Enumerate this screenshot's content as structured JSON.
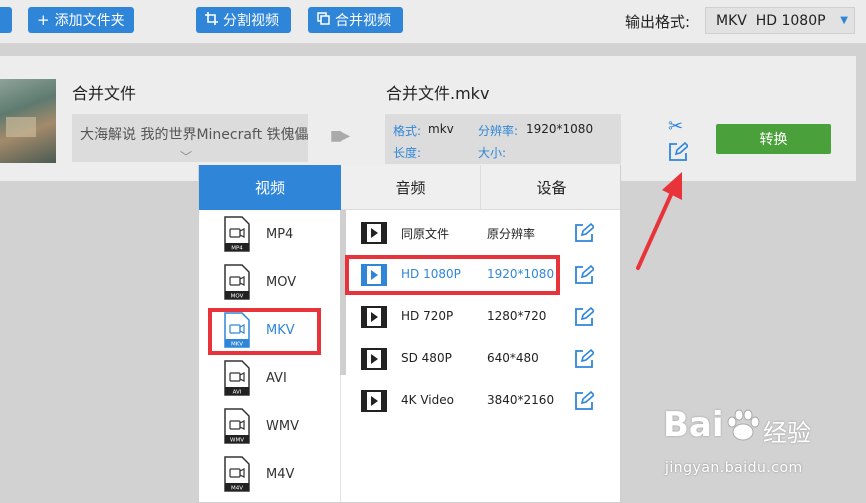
{
  "toolbar": {
    "add_folder": "添加文件夹",
    "split_video": "分割视频",
    "merge_video": "合并视频",
    "output_format_label": "输出格式:",
    "output_format_value": "MKV  HD 1080P"
  },
  "file": {
    "source_name": "合并文件",
    "source_detail": "大海解说 我的世界Minecraft 铁傀儡",
    "output_name": "合并文件.mkv",
    "format_key": "格式:",
    "format_value": "mkv",
    "resolution_key": "分辨率:",
    "resolution_value": "1920*1080",
    "duration_key": "长度:",
    "size_key": "大小:",
    "convert_label": "转换"
  },
  "popup": {
    "tabs": [
      "视频",
      "音频",
      "设备"
    ],
    "formats": [
      {
        "label": "MP4",
        "selected": false
      },
      {
        "label": "MOV",
        "selected": false
      },
      {
        "label": "MKV",
        "selected": true
      },
      {
        "label": "AVI",
        "selected": false
      },
      {
        "label": "WMV",
        "selected": false
      },
      {
        "label": "M4V",
        "selected": false
      }
    ],
    "presets": [
      {
        "name": "同原文件",
        "res": "原分辨率",
        "selected": false
      },
      {
        "name": "HD 1080P",
        "res": "1920*1080",
        "selected": true
      },
      {
        "name": "HD 720P",
        "res": "1280*720",
        "selected": false
      },
      {
        "name": "SD 480P",
        "res": "640*480",
        "selected": false
      },
      {
        "name": "4K Video",
        "res": "3840*2160",
        "selected": false
      }
    ]
  },
  "watermark": {
    "logo": "Bai",
    "logo_suffix": "经验",
    "url": "jingyan.baidu.com"
  },
  "colors": {
    "accent": "#2f86d9",
    "convert": "#4aa13b",
    "highlight": "#e8333a"
  }
}
